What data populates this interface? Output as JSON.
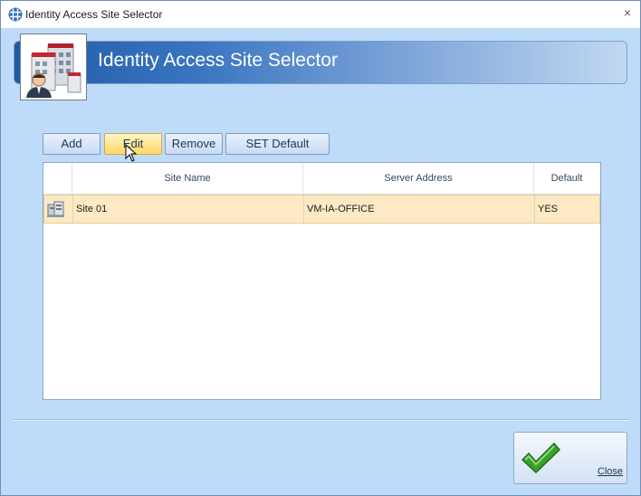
{
  "window": {
    "title": "Identity Access Site Selector",
    "close_glyph": "×",
    "app_icon": "grid-globe-icon"
  },
  "header": {
    "title": "Identity Access Site Selector",
    "image": "building-with-person-icon"
  },
  "toolbar": {
    "buttons": [
      {
        "label": "Add"
      },
      {
        "label": "Edit"
      },
      {
        "label": "Remove"
      },
      {
        "label": "SET Default"
      }
    ],
    "hovered": "Edit"
  },
  "grid": {
    "columns": [
      "",
      "Site Name",
      "Server Address",
      "Default"
    ],
    "rows": [
      {
        "icon": "server-icon",
        "site_name": "Site 01",
        "server_address": "VM-IA-OFFICE",
        "default": "YES",
        "selected": true
      }
    ]
  },
  "footer": {
    "close_label": "Close",
    "close_icon": "checkmark-icon"
  },
  "colors": {
    "window_bg": "#bfdbfa",
    "banner_start": "#1f5aa8",
    "selected_row": "#fde9c4",
    "hover_button": "#ffd765",
    "check_green": "#3aa12c"
  }
}
